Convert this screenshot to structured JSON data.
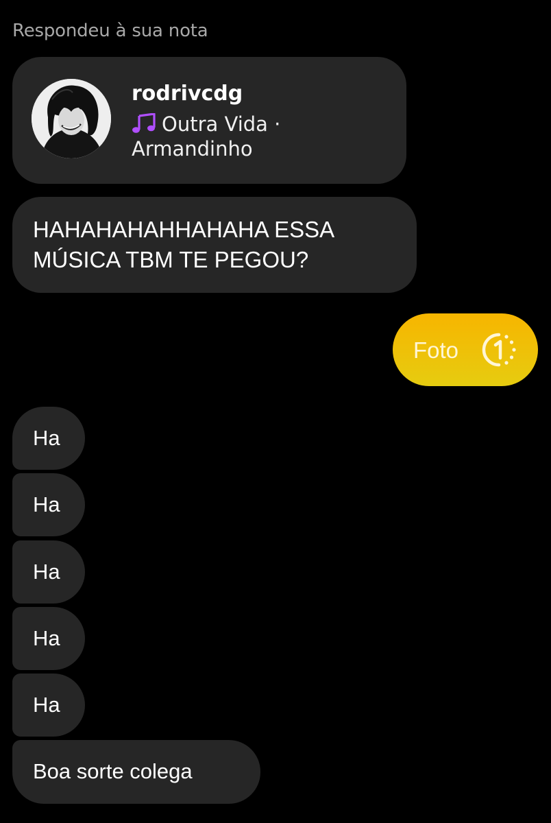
{
  "header": {
    "reply_label": "Respondeu à sua nota"
  },
  "note": {
    "username": "rodrivcdg",
    "song_line": "Outra Vida ·",
    "artist_line": "Armandinho",
    "music_icon": "music-note-icon",
    "music_icon_color": "#b04fff"
  },
  "messages": {
    "long": {
      "line1": "HAHAHAHAHHAHAHA ESSA",
      "line2": "MÚSICA TBM TE PEGOU?"
    },
    "photo": {
      "label": "Foto",
      "icon": "view-once-icon",
      "color": "#f5c400"
    },
    "ha": [
      "Ha",
      "Ha",
      "Ha",
      "Ha",
      "Ha"
    ],
    "last": "Boa sorte colega"
  },
  "colors": {
    "background": "#000000",
    "bubble": "#262626",
    "secondary_text": "#a8a8a8"
  }
}
